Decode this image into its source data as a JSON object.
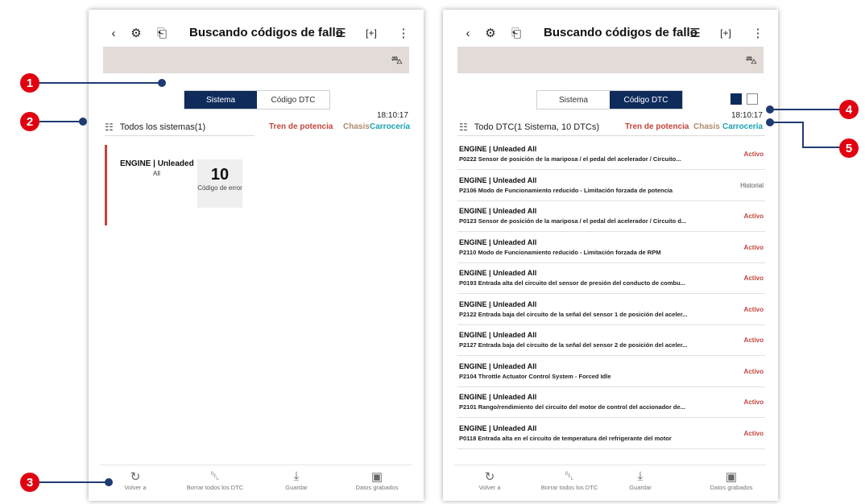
{
  "colors": {
    "navy": "#0e2b5c",
    "red_status": "#c4453b",
    "badge_red": "#e1000f",
    "teal": "#1aa3b5"
  },
  "common": {
    "title": "Buscando códigos de fallo",
    "tab_sistema": "Sistema",
    "tab_dtc": "Código DTC",
    "time": "18:10:17",
    "cat_tren": "Tren de potencia",
    "cat_chasis": "Chasis",
    "cat_carroceria": "Carrocería",
    "bottom": [
      "Volver a",
      "Borrar todos los DTC",
      "Guardar",
      "Datos grabados"
    ]
  },
  "panel1": {
    "filter_label": "Todos los sistemas(1)",
    "card": {
      "system": "ENGINE | Unleaded",
      "subsystem": "All",
      "count": "10",
      "count_label": "Código de error"
    }
  },
  "panel2": {
    "filter_label": "Todo DTC(1 Sistema, 10 DTCs)",
    "dtcs": [
      {
        "system": "ENGINE | Unleaded All",
        "desc": "P0222 Sensor de posición de la mariposa / el pedal del acelerador / Circuito...",
        "status": "Activo"
      },
      {
        "system": "ENGINE | Unleaded All",
        "desc": "P2106 Modo de Funcionamiento reducido - Limitación forzada de potencia",
        "status": "Historial"
      },
      {
        "system": "ENGINE | Unleaded All",
        "desc": "P0123 Sensor de posición de la mariposa / el pedal del acelerador / Circuito d...",
        "status": "Activo"
      },
      {
        "system": "ENGINE | Unleaded All",
        "desc": "P2110 Modo de Funcionamiento reducido - Limitación forzada de RPM",
        "status": "Activo"
      },
      {
        "system": "ENGINE | Unleaded All",
        "desc": "P0193 Entrada alta del circuito del sensor de presión del conducto de combu...",
        "status": "Activo"
      },
      {
        "system": "ENGINE | Unleaded All",
        "desc": "P2122 Entrada baja del circuito de la señal del sensor 1 de posición del aceler...",
        "status": "Activo"
      },
      {
        "system": "ENGINE | Unleaded All",
        "desc": "P2127 Entrada baja del circuito de la señal del sensor 2 de posición del aceler...",
        "status": "Activo"
      },
      {
        "system": "ENGINE | Unleaded All",
        "desc": "P2104 Throttle Actuator Control System - Forced Idle",
        "status": "Activo"
      },
      {
        "system": "ENGINE | Unleaded All",
        "desc": "P2101 Rango/rendimiento del circuito del motor de control del accionador de...",
        "status": "Activo"
      },
      {
        "system": "ENGINE | Unleaded All",
        "desc": "P0118 Entrada alta en el circuito de temperatura del refrigerante del motor",
        "status": "Activo"
      }
    ]
  },
  "annotations": [
    "1",
    "2",
    "3",
    "4",
    "5"
  ]
}
